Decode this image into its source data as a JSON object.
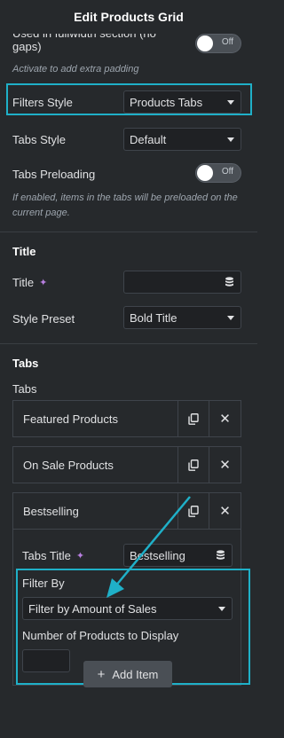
{
  "header": {
    "title": "Edit Products Grid"
  },
  "fullwidth": {
    "label": "Used in fullwidth section (no gaps)",
    "toggle_text": "Off",
    "description": "Activate to add extra padding"
  },
  "filters_style": {
    "label": "Filters Style",
    "value": "Products Tabs"
  },
  "tabs_style": {
    "label": "Tabs Style",
    "value": "Default"
  },
  "tabs_preloading": {
    "label": "Tabs Preloading",
    "toggle_text": "Off",
    "description": "If enabled, items in the tabs will be preloaded on the current page."
  },
  "title_section": {
    "heading": "Title",
    "title_label": "Title",
    "title_value": "",
    "style_preset_label": "Style Preset",
    "style_preset_value": "Bold Title"
  },
  "tabs_section": {
    "heading": "Tabs",
    "sublabel": "Tabs",
    "items": [
      {
        "label": "Featured Products"
      },
      {
        "label": "On Sale Products"
      },
      {
        "label": "Bestselling"
      }
    ]
  },
  "expanded_tab": {
    "tabs_title_label": "Tabs Title",
    "tabs_title_value": "Bestselling",
    "filter_by_label": "Filter By",
    "filter_by_value": "Filter by Amount of Sales",
    "num_products_label": "Number of Products to Display",
    "num_products_value": ""
  },
  "add_item": {
    "label": "Add Item"
  },
  "icons": {
    "copy": "copy-icon",
    "close": "close-icon",
    "database": "database-icon",
    "sparkle": "ai-sparkle-icon",
    "plus": "plus-icon",
    "caret": "chevron-down-icon"
  },
  "colors": {
    "highlight": "#1fb0c8",
    "background": "#26292c",
    "input_bg": "#1f2124"
  }
}
